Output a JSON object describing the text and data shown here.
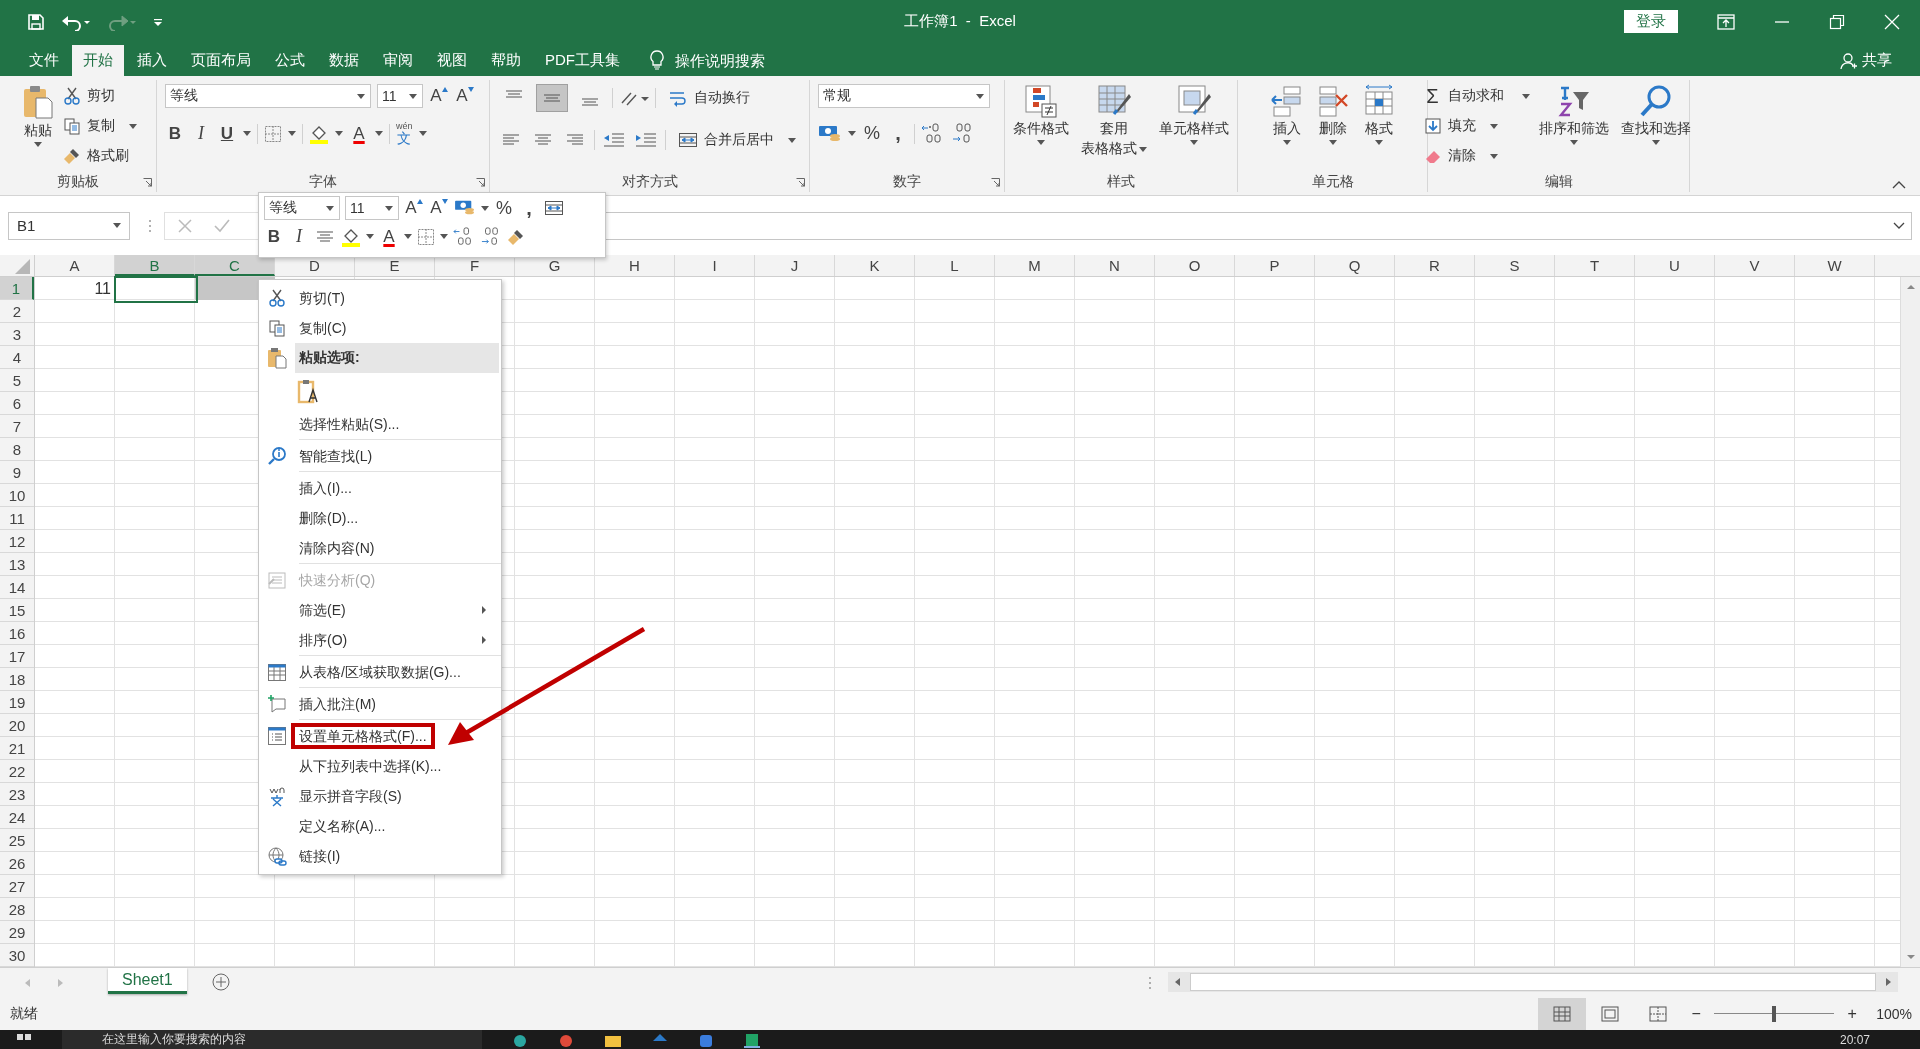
{
  "title_bar": {
    "title": "工作簿1  -  Excel",
    "login": "登录",
    "redo_disabled": true
  },
  "ribbon_tabs": [
    {
      "label": "文件",
      "selected": false
    },
    {
      "label": "开始",
      "selected": true
    },
    {
      "label": "插入",
      "selected": false
    },
    {
      "label": "页面布局",
      "selected": false
    },
    {
      "label": "公式",
      "selected": false
    },
    {
      "label": "数据",
      "selected": false
    },
    {
      "label": "审阅",
      "selected": false
    },
    {
      "label": "视图",
      "selected": false
    },
    {
      "label": "帮助",
      "selected": false
    },
    {
      "label": "PDF工具集",
      "selected": false
    }
  ],
  "tell_me": "操作说明搜索",
  "share": "共享",
  "clipboard": {
    "label": "剪贴板",
    "paste": "粘贴",
    "cut": "剪切",
    "copy": "复制",
    "format_painter": "格式刷"
  },
  "font": {
    "label": "字体",
    "family": "等线",
    "size": "11",
    "grow": "A",
    "shrink": "A",
    "bold": "B",
    "italic": "I",
    "underline": "U",
    "font_color": "A",
    "phonetic_top": "wén",
    "phonetic": "文"
  },
  "alignment": {
    "label": "对齐方式",
    "wrap": "自动换行",
    "merge": "合并后居中",
    "vertical": [
      {
        "selected": false
      },
      {
        "selected": true
      },
      {
        "selected": false
      }
    ]
  },
  "number": {
    "label": "数字",
    "format": "常规",
    "percent": "%",
    "comma": ","
  },
  "styles": {
    "label": "样式",
    "buttons": [
      {
        "lines": [
          "条件格式"
        ]
      },
      {
        "lines": [
          "套用",
          "表格格式"
        ]
      },
      {
        "lines": [
          "单元格样式"
        ]
      }
    ]
  },
  "cells_group": {
    "label": "单元格",
    "buttons": [
      "插入",
      "删除",
      "格式"
    ]
  },
  "editing": {
    "label": "编辑",
    "sigma": "Σ",
    "autosum": "自动求和",
    "fill": "填充",
    "clear": "清除",
    "sort": "排序和筛选",
    "find": "查找和选择"
  },
  "formula_bar": {
    "name_box": "B1"
  },
  "mini_toolbar": {
    "family": "等线",
    "size": "11",
    "grow": "A",
    "shrink": "A",
    "percent": "%",
    "comma": ",",
    "bold": "B",
    "italic": "I",
    "font_color": "A"
  },
  "columns": [
    {
      "label": "A",
      "selected": false
    },
    {
      "label": "B",
      "selected": true
    },
    {
      "label": "C",
      "selected": true
    },
    {
      "label": "D",
      "selected": false
    },
    {
      "label": "E",
      "selected": false
    },
    {
      "label": "F",
      "selected": false
    },
    {
      "label": "G",
      "selected": false
    },
    {
      "label": "H",
      "selected": false
    },
    {
      "label": "I",
      "selected": false
    },
    {
      "label": "J",
      "selected": false
    },
    {
      "label": "K",
      "selected": false
    },
    {
      "label": "L",
      "selected": false
    },
    {
      "label": "M",
      "selected": false
    },
    {
      "label": "N",
      "selected": false
    },
    {
      "label": "O",
      "selected": false
    },
    {
      "label": "P",
      "selected": false
    },
    {
      "label": "Q",
      "selected": false
    },
    {
      "label": "R",
      "selected": false
    },
    {
      "label": "S",
      "selected": false
    },
    {
      "label": "T",
      "selected": false
    },
    {
      "label": "U",
      "selected": false
    },
    {
      "label": "V",
      "selected": false
    },
    {
      "label": "W",
      "selected": false
    }
  ],
  "rows": [
    {
      "label": "1",
      "selected": true
    },
    {
      "label": "2",
      "selected": false
    },
    {
      "label": "3",
      "selected": false
    },
    {
      "label": "4",
      "selected": false
    },
    {
      "label": "5",
      "selected": false
    },
    {
      "label": "6",
      "selected": false
    },
    {
      "label": "7",
      "selected": false
    },
    {
      "label": "8",
      "selected": false
    },
    {
      "label": "9",
      "selected": false
    },
    {
      "label": "10",
      "selected": false
    },
    {
      "label": "11",
      "selected": false
    },
    {
      "label": "12",
      "selected": false
    },
    {
      "label": "13",
      "selected": false
    },
    {
      "label": "14",
      "selected": false
    },
    {
      "label": "15",
      "selected": false
    },
    {
      "label": "16",
      "selected": false
    },
    {
      "label": "17",
      "selected": false
    },
    {
      "label": "18",
      "selected": false
    },
    {
      "label": "19",
      "selected": false
    },
    {
      "label": "20",
      "selected": false
    },
    {
      "label": "21",
      "selected": false
    },
    {
      "label": "22",
      "selected": false
    },
    {
      "label": "23",
      "selected": false
    },
    {
      "label": "24",
      "selected": false
    },
    {
      "label": "25",
      "selected": false
    },
    {
      "label": "26",
      "selected": false
    },
    {
      "label": "27",
      "selected": false
    },
    {
      "label": "28",
      "selected": false
    },
    {
      "label": "29",
      "selected": false
    },
    {
      "label": "30",
      "selected": false
    }
  ],
  "a1": "11",
  "context_menu": [
    {
      "kind": "item",
      "label": "剪切(T)",
      "disabled": false,
      "submenu": false,
      "annotated": false
    },
    {
      "kind": "item",
      "label": "复制(C)",
      "disabled": false,
      "submenu": false,
      "annotated": false
    },
    {
      "kind": "header",
      "label": "粘贴选项:"
    },
    {
      "kind": "paste-option"
    },
    {
      "kind": "item",
      "label": "选择性粘贴(S)...",
      "disabled": false,
      "submenu": false,
      "annotated": false
    },
    {
      "kind": "separator"
    },
    {
      "kind": "item",
      "label": "智能查找(L)",
      "disabled": false,
      "submenu": false,
      "annotated": false
    },
    {
      "kind": "separator"
    },
    {
      "kind": "item",
      "label": "插入(I)...",
      "disabled": false,
      "submenu": false,
      "annotated": false
    },
    {
      "kind": "item",
      "label": "删除(D)...",
      "disabled": false,
      "submenu": false,
      "annotated": false
    },
    {
      "kind": "item",
      "label": "清除内容(N)",
      "disabled": false,
      "submenu": false,
      "annotated": false
    },
    {
      "kind": "separator"
    },
    {
      "kind": "item",
      "label": "快速分析(Q)",
      "disabled": true,
      "submenu": false,
      "annotated": false
    },
    {
      "kind": "item",
      "label": "筛选(E)",
      "disabled": false,
      "submenu": true,
      "annotated": false
    },
    {
      "kind": "item",
      "label": "排序(O)",
      "disabled": false,
      "submenu": true,
      "annotated": false
    },
    {
      "kind": "separator"
    },
    {
      "kind": "item",
      "label": "从表格/区域获取数据(G)...",
      "disabled": false,
      "submenu": false,
      "annotated": false
    },
    {
      "kind": "separator"
    },
    {
      "kind": "item",
      "label": "插入批注(M)",
      "disabled": false,
      "submenu": false,
      "annotated": false
    },
    {
      "kind": "separator"
    },
    {
      "kind": "item",
      "label": "设置单元格格式(F)...",
      "disabled": false,
      "submenu": false,
      "annotated": true
    },
    {
      "kind": "item",
      "label": "从下拉列表中选择(K)...",
      "disabled": false,
      "submenu": false,
      "annotated": false
    },
    {
      "kind": "item",
      "label": "显示拼音字段(S)",
      "disabled": false,
      "submenu": false,
      "annotated": false
    },
    {
      "kind": "item",
      "label": "定义名称(A)...",
      "disabled": false,
      "submenu": false,
      "annotated": false
    },
    {
      "kind": "item",
      "label": "链接(I)",
      "disabled": false,
      "submenu": false,
      "annotated": false
    }
  ],
  "sheet_tabs": [
    {
      "label": "Sheet1",
      "selected": true
    }
  ],
  "status_bar": {
    "status": "就绪",
    "views": [
      {
        "selected": true
      },
      {
        "selected": false
      },
      {
        "selected": false
      }
    ],
    "zoom_minus": "−",
    "zoom_plus": "+",
    "zoom": {
      "level": 0.5
    },
    "zoom_reading": "100%"
  },
  "taskbar": {
    "search": "在这里输入你要搜索的内容",
    "time": "20:07"
  }
}
